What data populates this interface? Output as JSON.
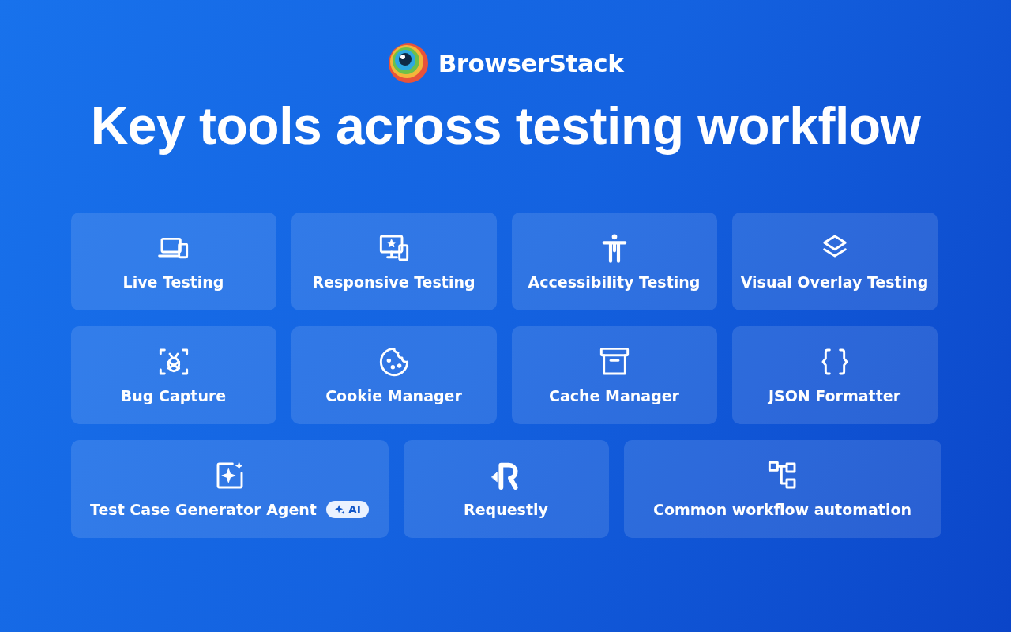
{
  "brand": {
    "name": "BrowserStack"
  },
  "title": "Key tools across testing workflow",
  "rows": [
    [
      {
        "kind": "devices",
        "label": "Live Testing"
      },
      {
        "kind": "responsive",
        "label": "Responsive Testing"
      },
      {
        "kind": "person",
        "label": "Accessibility Testing"
      },
      {
        "kind": "layers",
        "label": "Visual Overlay Testing"
      }
    ],
    [
      {
        "kind": "bug",
        "label": "Bug Capture"
      },
      {
        "kind": "cookie",
        "label": "Cookie Manager"
      },
      {
        "kind": "archive",
        "label": "Cache Manager"
      },
      {
        "kind": "braces",
        "label": "JSON Formatter"
      }
    ],
    [
      {
        "kind": "sparkle",
        "label": "Test Case Generator Agent",
        "badge": "AI"
      },
      {
        "kind": "requestly",
        "label": "Requestly"
      },
      {
        "kind": "flow",
        "label": "Common workflow automation"
      }
    ]
  ]
}
